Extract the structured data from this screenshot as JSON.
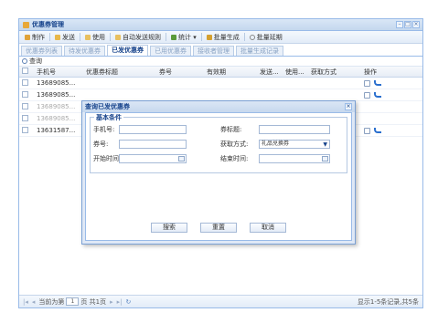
{
  "window": {
    "title": "优惠券管理"
  },
  "toolbar": {
    "items": [
      "制作",
      "发送",
      "使用",
      "自动发送规则",
      "统计",
      "批量生成",
      "批量延期"
    ],
    "stats_arrow": "▾"
  },
  "tabs": [
    "优惠券列表",
    "待发优惠券",
    "已发优惠券",
    "已用优惠券",
    "接收者管理",
    "批量生成记录"
  ],
  "active_tab": 2,
  "query": {
    "label": "查询"
  },
  "grid": {
    "columns": [
      "手机号",
      "优惠券标题",
      "券号",
      "有效期",
      "发送...",
      "使用...",
      "获取方式",
      "操作"
    ],
    "rows": [
      {
        "phone": "13689085..."
      },
      {
        "phone": "13689085..."
      },
      {
        "phone": "13689085..."
      },
      {
        "phone": "13689085..."
      },
      {
        "phone": "13631587..."
      }
    ]
  },
  "pager": {
    "page_prefix": "当前为第",
    "page_value": "1",
    "page_suffix": "页 共1页",
    "info": "显示1-5条记录,共5条"
  },
  "dialog": {
    "title": "查询已发优惠券",
    "legend": "基本条件",
    "fields": {
      "phone_label": "手机号:",
      "title_label": "券标题:",
      "code_label": "券号:",
      "method_label": "获取方式:",
      "method_value": "礼品兑换券",
      "start_label": "开始时间:",
      "end_label": "结束时间:"
    },
    "buttons": {
      "search": "搜索",
      "reset": "重置",
      "cancel": "取消"
    }
  }
}
